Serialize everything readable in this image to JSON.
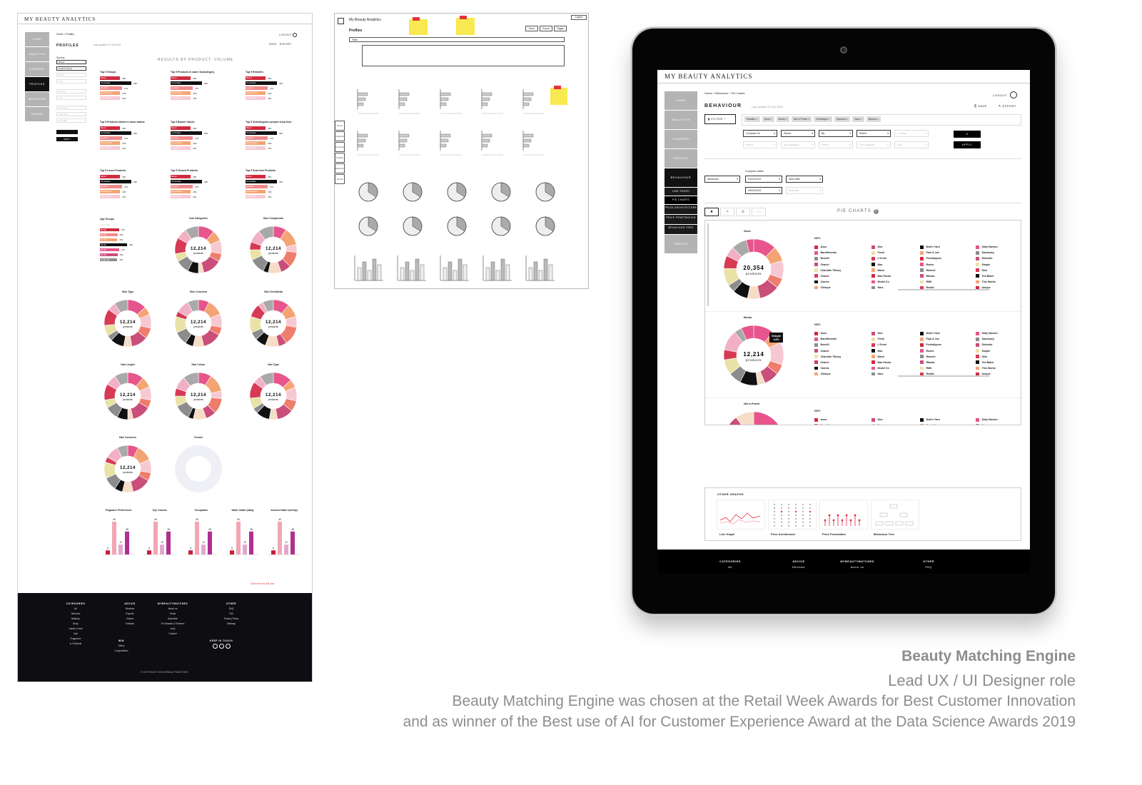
{
  "left_page": {
    "app_title": "MY BEAUTY ANALYTICS",
    "breadcrumb": "Home > Profiles",
    "logout": "LOGOUT",
    "page_heading": "PROFILES",
    "last_update": "Last update 21 Oct 2015",
    "save": "SAVE",
    "export": "EXPORT",
    "nav": [
      "HOME",
      "ANALYTICS",
      "COMPARE",
      "PROFILES",
      "BEHAVIOUR",
      "TRENDS"
    ],
    "sort_label": "Sort by:",
    "sort_values": [
      "Brand",
      "Product Name"
    ],
    "filter_placeholders": [
      "Select",
      "Type",
      "Country",
      "City",
      "Measures",
      "Start date",
      "End date"
    ],
    "apply": "APPLY",
    "results_title": "RESULTS BY PRODUCT: VOLUME",
    "bar_blocks": [
      {
        "title": "Top 5 Groups",
        "rows": [
          {
            "label": "Blush",
            "value": "250"
          },
          {
            "label": "Concealer",
            "value": "390"
          },
          {
            "label": "Eyeliner",
            "value": "276"
          },
          {
            "label": "Eyeshadow",
            "value": "252"
          },
          {
            "label": "Foundation",
            "value": "251"
          }
        ]
      },
      {
        "title": "Top 5 Products in same Subcategory",
        "rows": [
          {
            "label": "Blush",
            "value": "250"
          },
          {
            "label": "Concealer",
            "value": "390"
          },
          {
            "label": "Eyeliner",
            "value": "276"
          },
          {
            "label": "Eyeshadow",
            "value": "252"
          },
          {
            "label": "Foundation",
            "value": "251"
          }
        ]
      },
      {
        "title": "Top 5 Retailers",
        "rows": [
          {
            "label": "Blush",
            "value": "250"
          },
          {
            "label": "Concealer",
            "value": "390"
          },
          {
            "label": "Eyeliner",
            "value": "276"
          },
          {
            "label": "Eyeshadow",
            "value": "252"
          },
          {
            "label": "Foundation",
            "value": "251"
          }
        ]
      },
      {
        "title": "Top 5 Products added in same basket",
        "rows": [
          {
            "label": "Blush",
            "value": "250"
          },
          {
            "label": "Concealer",
            "value": "390"
          },
          {
            "label": "Eyeliner",
            "value": "276"
          },
          {
            "label": "Eyeshadow",
            "value": "252"
          },
          {
            "label": "Foundation",
            "value": "251"
          }
        ]
      },
      {
        "title": "Top 5 Basket Values",
        "rows": [
          {
            "label": "Blush",
            "value": "250"
          },
          {
            "label": "Concealer",
            "value": "390"
          },
          {
            "label": "Eyeliner",
            "value": "276"
          },
          {
            "label": "Eyeshadow",
            "value": "252"
          },
          {
            "label": "Foundation",
            "value": "251"
          }
        ]
      },
      {
        "title": "Top 5 Subcategories people shop from",
        "rows": [
          {
            "label": "Blush",
            "value": "250"
          },
          {
            "label": "Concealer",
            "value": "390"
          },
          {
            "label": "Eyeliner",
            "value": "276"
          },
          {
            "label": "Eyeshadow",
            "value": "252"
          },
          {
            "label": "Foundation",
            "value": "251"
          }
        ]
      },
      {
        "title": "Top 5 Loved Products",
        "rows": [
          {
            "label": "Blush",
            "value": "250"
          },
          {
            "label": "Concealer",
            "value": "390"
          },
          {
            "label": "Eyeliner",
            "value": "276"
          },
          {
            "label": "Eyeshadow",
            "value": "252"
          },
          {
            "label": "Foundation",
            "value": "251"
          }
        ]
      },
      {
        "title": "Top 5 Viewed Products",
        "rows": [
          {
            "label": "Blush",
            "value": "250"
          },
          {
            "label": "Concealer",
            "value": "390"
          },
          {
            "label": "Eyeliner",
            "value": "276"
          },
          {
            "label": "Eyeshadow",
            "value": "252"
          },
          {
            "label": "Foundation",
            "value": "251"
          }
        ]
      },
      {
        "title": "Top 5 Searched Products",
        "rows": [
          {
            "label": "Blush",
            "value": "250"
          },
          {
            "label": "Concealer",
            "value": "390"
          },
          {
            "label": "Eyeliner",
            "value": "276"
          },
          {
            "label": "Eyeshadow",
            "value": "252"
          },
          {
            "label": "Foundation",
            "value": "251"
          }
        ]
      }
    ],
    "age_groups": {
      "title": "Age Groups",
      "rows": [
        {
          "label": "Over 100",
          "value": ""
        },
        {
          "label": "90-99",
          "value": "276"
        },
        {
          "label": "80-89",
          "value": "252"
        },
        {
          "label": "70-79",
          "value": "251"
        },
        {
          "label": "60-69",
          "value": "390"
        },
        {
          "label": "50-59",
          "value": "276"
        },
        {
          "label": "40-49",
          "value": "252"
        },
        {
          "label": "Under 20",
          "value": "251"
        }
      ]
    },
    "donut_center_value": "12,214",
    "donut_center_label": "products",
    "donuts": [
      "Sub Categories",
      "Skin Complexion",
      "Skin Type",
      "Skin Concerns",
      "Skin Sensitivity",
      "Hair Length",
      "Hair Colour",
      "Hair Type",
      "Hair Concerns",
      "Texture"
    ],
    "small_bar_charts": [
      {
        "title": "Fragrance Preferences",
        "values": [
          "5",
          "40",
          "12",
          "28"
        ]
      },
      {
        "title": "Eye Colours",
        "values": [
          "5",
          "40",
          "12",
          "28"
        ]
      },
      {
        "title": "Occupation",
        "values": [
          "5",
          "40",
          "12",
          "28"
        ]
      },
      {
        "title": "Water Intake (daily)",
        "values": [
          "5",
          "40",
          "12",
          "28"
        ]
      },
      {
        "title": "Alcohol Intake (weekly)",
        "values": [
          "5",
          "40",
          "12",
          "28"
        ]
      }
    ],
    "footnote": "Click here for full size",
    "footer": {
      "columns": [
        {
          "heading": "CATEGORIES",
          "items": [
            "All",
            "Skincare",
            "Makeup",
            "Body",
            "Hands & feet",
            "Hair",
            "Fragrance",
            "A-Z Brands"
          ]
        },
        {
          "heading": "ADVICE",
          "items": [
            "Reviews",
            "Experts",
            "Videos",
            "Editorial"
          ]
        },
        {
          "heading": "MYBEAUTYMATCHES",
          "items": [
            "About us",
            "Press",
            "Advertise",
            "For Brands & Partners",
            "Jobs",
            "Contact"
          ]
        },
        {
          "heading": "OTHER",
          "items": [
            "FAQ",
            "T&C",
            "Privacy Policy",
            "Sitemap"
          ]
        }
      ],
      "win_heading": "WIN",
      "win_items": [
        "Offers",
        "Competitions"
      ],
      "touch_heading": "KEEP IN TOUCH",
      "copyright": "© COPYRIGHT 2015 MYBEAUTYMATCHES"
    }
  },
  "wireframe": {
    "title": "My Beauty Analytics",
    "subtitle": "Profiles",
    "logout": "Logout",
    "buttons": [
      "Save",
      "Export",
      "Toggle"
    ],
    "filter": "Filter",
    "side_tabs": [
      "Home",
      "Analytics",
      "Compare",
      "Profiles",
      "Behaviour",
      "Trends"
    ]
  },
  "tablet": {
    "app_title": "MY BEAUTY ANALYTICS",
    "breadcrumb": "Home > Behaviour > Pie Charts",
    "logout": "LOGOUT",
    "page_heading": "BEHAVIOUR",
    "last_update": "Last update 21 Oct 2015",
    "save": "SAVE",
    "export": "EXPORT",
    "nav": [
      "HOME",
      "ANALYTICS",
      "COMPARE",
      "PROFILE",
      "BEHAVIOUR"
    ],
    "sub_nav": [
      "LINE GRAPH",
      "PIE CHARTS",
      "PRICE ARCHITECTURE",
      "PRICE PENETRATION",
      "BEHAVIOUR TREE"
    ],
    "nav_trends": "TRENDS",
    "filter_button": "FILTER",
    "chips": [
      "Retailer",
      "Asos",
      "Boots",
      "Net a Porter",
      "Selfridges",
      "Topshop",
      "Zara",
      "Brands"
    ],
    "row1_selects": [
      "Compare for",
      "Select",
      "By",
      "Select",
      "Country"
    ],
    "row2_selects": [
      "Select",
      "Sub category",
      "Select",
      "Sub category",
      "City"
    ],
    "close_btn": "X",
    "apply_btn": "APPLY",
    "measures": "Measures",
    "compare_dates": "Compare dates",
    "date1": "01/01/2015",
    "date2": "30/01/2015",
    "start_date": "Start date",
    "end_date": "End date",
    "pie_title": "PIE CHARTS",
    "key_label": "KEY:",
    "key_items": [
      "Asos",
      "BareMinerals",
      "Benefit",
      "Chanel",
      "Charlotte Tilbury",
      "Chanel",
      "Clarins",
      "Clinique",
      "Dior",
      "Fresh",
      "L'Oreal",
      "Mac",
      "Marni",
      "Max Factor",
      "Model Co",
      "Nars",
      "Neal's Yard",
      "Paul & Joe",
      "Penhaligons",
      "Rodex",
      "Rimmel",
      "Rituals",
      "RMK",
      "Rodial",
      "Sally Hansen",
      "Sanctuary",
      "Shiseido",
      "Simple",
      "Skin",
      "Ted Baker",
      "This Works",
      "Unique"
    ],
    "charts": [
      {
        "name": "Asos",
        "center_value": "20,354",
        "center_label": "products"
      },
      {
        "name": "Boots",
        "center_value": "12,214",
        "center_label": "products",
        "tooltip_label": "Simple",
        "tooltip_value": "14%"
      },
      {
        "name": "Net a Porter"
      }
    ],
    "other_graphs_title": "OTHER GRAPHS",
    "other_graphs": [
      "Line Graph",
      "Price Architecture",
      "Price Penetration",
      "Behaviour Tree"
    ],
    "footer": [
      {
        "heading": "CATEGORIES",
        "item": "All"
      },
      {
        "heading": "ADVICE",
        "item": "Reviews"
      },
      {
        "heading": "MYBEAUTYMATCHES",
        "item": "About us"
      },
      {
        "heading": "OTHER",
        "item": "FAQ"
      }
    ]
  },
  "caption": {
    "title": "Beauty Matching Engine",
    "role": "Lead UX / UI Designer role",
    "line1": "Beauty Matching Engine was chosen at the Retail Week Awards for Best Customer Innovation",
    "line2": "and as winner of the Best use of AI for Customer Experience Award at the Data Science Awards 2019"
  },
  "palette": {
    "bar_colors": [
      "#cf2b3f",
      "#111111",
      "#f08a8a",
      "#f4a473",
      "#f6c9d2"
    ],
    "donut_colors": [
      "#e7558c",
      "#f4a473",
      "#f6c9d2",
      "#ef7d6b",
      "#c94e7a",
      "#f7dcc6",
      "#111111",
      "#8c8c8c",
      "#e9e2a6",
      "#d63a55",
      "#f2b0c4",
      "#a9a9a9"
    ],
    "key_colors": [
      "#cf2b3f",
      "#c94e7a",
      "#111111",
      "#e7558c",
      "#e9e2a6",
      "#f4a473",
      "#8c8c8c",
      "#d63a55"
    ],
    "small_bar_colors": [
      "#c81f3a",
      "#f2a6b3",
      "#e2a8d0",
      "#b12f8f"
    ]
  }
}
